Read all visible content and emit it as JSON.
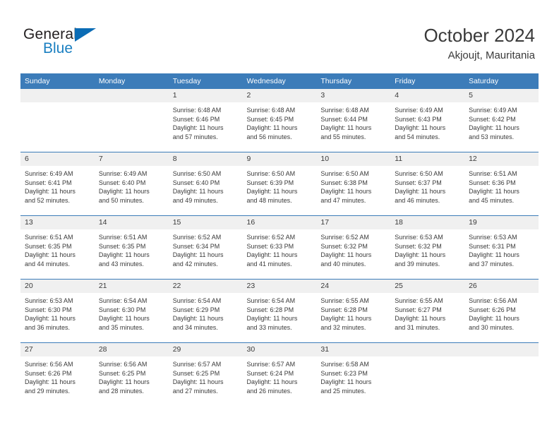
{
  "brand": {
    "line1": "General",
    "line2": "Blue",
    "triangle_icon": "brand-triangle-icon",
    "accent_color": "#0b6cb5",
    "text_blue": "#1a7fc1"
  },
  "header": {
    "title": "October 2024",
    "subtitle": "Akjoujt, Mauritania"
  },
  "theme": {
    "header_blue": "#3c7cb9",
    "daynum_band": "#f0f0f0",
    "text": "#3a3a3a"
  },
  "weekday_headers": [
    "Sunday",
    "Monday",
    "Tuesday",
    "Wednesday",
    "Thursday",
    "Friday",
    "Saturday"
  ],
  "labels": {
    "sunrise_prefix": "Sunrise:",
    "sunset_prefix": "Sunset:",
    "daylight_prefix": "Daylight:"
  },
  "weeks": [
    [
      {
        "day": "",
        "sunrise": "",
        "sunset": "",
        "daylight_line1": "",
        "daylight_line2": ""
      },
      {
        "day": "",
        "sunrise": "",
        "sunset": "",
        "daylight_line1": "",
        "daylight_line2": ""
      },
      {
        "day": "1",
        "sunrise": "Sunrise: 6:48 AM",
        "sunset": "Sunset: 6:46 PM",
        "daylight_line1": "Daylight: 11 hours",
        "daylight_line2": "and 57 minutes."
      },
      {
        "day": "2",
        "sunrise": "Sunrise: 6:48 AM",
        "sunset": "Sunset: 6:45 PM",
        "daylight_line1": "Daylight: 11 hours",
        "daylight_line2": "and 56 minutes."
      },
      {
        "day": "3",
        "sunrise": "Sunrise: 6:48 AM",
        "sunset": "Sunset: 6:44 PM",
        "daylight_line1": "Daylight: 11 hours",
        "daylight_line2": "and 55 minutes."
      },
      {
        "day": "4",
        "sunrise": "Sunrise: 6:49 AM",
        "sunset": "Sunset: 6:43 PM",
        "daylight_line1": "Daylight: 11 hours",
        "daylight_line2": "and 54 minutes."
      },
      {
        "day": "5",
        "sunrise": "Sunrise: 6:49 AM",
        "sunset": "Sunset: 6:42 PM",
        "daylight_line1": "Daylight: 11 hours",
        "daylight_line2": "and 53 minutes."
      }
    ],
    [
      {
        "day": "6",
        "sunrise": "Sunrise: 6:49 AM",
        "sunset": "Sunset: 6:41 PM",
        "daylight_line1": "Daylight: 11 hours",
        "daylight_line2": "and 52 minutes."
      },
      {
        "day": "7",
        "sunrise": "Sunrise: 6:49 AM",
        "sunset": "Sunset: 6:40 PM",
        "daylight_line1": "Daylight: 11 hours",
        "daylight_line2": "and 50 minutes."
      },
      {
        "day": "8",
        "sunrise": "Sunrise: 6:50 AM",
        "sunset": "Sunset: 6:40 PM",
        "daylight_line1": "Daylight: 11 hours",
        "daylight_line2": "and 49 minutes."
      },
      {
        "day": "9",
        "sunrise": "Sunrise: 6:50 AM",
        "sunset": "Sunset: 6:39 PM",
        "daylight_line1": "Daylight: 11 hours",
        "daylight_line2": "and 48 minutes."
      },
      {
        "day": "10",
        "sunrise": "Sunrise: 6:50 AM",
        "sunset": "Sunset: 6:38 PM",
        "daylight_line1": "Daylight: 11 hours",
        "daylight_line2": "and 47 minutes."
      },
      {
        "day": "11",
        "sunrise": "Sunrise: 6:50 AM",
        "sunset": "Sunset: 6:37 PM",
        "daylight_line1": "Daylight: 11 hours",
        "daylight_line2": "and 46 minutes."
      },
      {
        "day": "12",
        "sunrise": "Sunrise: 6:51 AM",
        "sunset": "Sunset: 6:36 PM",
        "daylight_line1": "Daylight: 11 hours",
        "daylight_line2": "and 45 minutes."
      }
    ],
    [
      {
        "day": "13",
        "sunrise": "Sunrise: 6:51 AM",
        "sunset": "Sunset: 6:35 PM",
        "daylight_line1": "Daylight: 11 hours",
        "daylight_line2": "and 44 minutes."
      },
      {
        "day": "14",
        "sunrise": "Sunrise: 6:51 AM",
        "sunset": "Sunset: 6:35 PM",
        "daylight_line1": "Daylight: 11 hours",
        "daylight_line2": "and 43 minutes."
      },
      {
        "day": "15",
        "sunrise": "Sunrise: 6:52 AM",
        "sunset": "Sunset: 6:34 PM",
        "daylight_line1": "Daylight: 11 hours",
        "daylight_line2": "and 42 minutes."
      },
      {
        "day": "16",
        "sunrise": "Sunrise: 6:52 AM",
        "sunset": "Sunset: 6:33 PM",
        "daylight_line1": "Daylight: 11 hours",
        "daylight_line2": "and 41 minutes."
      },
      {
        "day": "17",
        "sunrise": "Sunrise: 6:52 AM",
        "sunset": "Sunset: 6:32 PM",
        "daylight_line1": "Daylight: 11 hours",
        "daylight_line2": "and 40 minutes."
      },
      {
        "day": "18",
        "sunrise": "Sunrise: 6:53 AM",
        "sunset": "Sunset: 6:32 PM",
        "daylight_line1": "Daylight: 11 hours",
        "daylight_line2": "and 39 minutes."
      },
      {
        "day": "19",
        "sunrise": "Sunrise: 6:53 AM",
        "sunset": "Sunset: 6:31 PM",
        "daylight_line1": "Daylight: 11 hours",
        "daylight_line2": "and 37 minutes."
      }
    ],
    [
      {
        "day": "20",
        "sunrise": "Sunrise: 6:53 AM",
        "sunset": "Sunset: 6:30 PM",
        "daylight_line1": "Daylight: 11 hours",
        "daylight_line2": "and 36 minutes."
      },
      {
        "day": "21",
        "sunrise": "Sunrise: 6:54 AM",
        "sunset": "Sunset: 6:30 PM",
        "daylight_line1": "Daylight: 11 hours",
        "daylight_line2": "and 35 minutes."
      },
      {
        "day": "22",
        "sunrise": "Sunrise: 6:54 AM",
        "sunset": "Sunset: 6:29 PM",
        "daylight_line1": "Daylight: 11 hours",
        "daylight_line2": "and 34 minutes."
      },
      {
        "day": "23",
        "sunrise": "Sunrise: 6:54 AM",
        "sunset": "Sunset: 6:28 PM",
        "daylight_line1": "Daylight: 11 hours",
        "daylight_line2": "and 33 minutes."
      },
      {
        "day": "24",
        "sunrise": "Sunrise: 6:55 AM",
        "sunset": "Sunset: 6:28 PM",
        "daylight_line1": "Daylight: 11 hours",
        "daylight_line2": "and 32 minutes."
      },
      {
        "day": "25",
        "sunrise": "Sunrise: 6:55 AM",
        "sunset": "Sunset: 6:27 PM",
        "daylight_line1": "Daylight: 11 hours",
        "daylight_line2": "and 31 minutes."
      },
      {
        "day": "26",
        "sunrise": "Sunrise: 6:56 AM",
        "sunset": "Sunset: 6:26 PM",
        "daylight_line1": "Daylight: 11 hours",
        "daylight_line2": "and 30 minutes."
      }
    ],
    [
      {
        "day": "27",
        "sunrise": "Sunrise: 6:56 AM",
        "sunset": "Sunset: 6:26 PM",
        "daylight_line1": "Daylight: 11 hours",
        "daylight_line2": "and 29 minutes."
      },
      {
        "day": "28",
        "sunrise": "Sunrise: 6:56 AM",
        "sunset": "Sunset: 6:25 PM",
        "daylight_line1": "Daylight: 11 hours",
        "daylight_line2": "and 28 minutes."
      },
      {
        "day": "29",
        "sunrise": "Sunrise: 6:57 AM",
        "sunset": "Sunset: 6:25 PM",
        "daylight_line1": "Daylight: 11 hours",
        "daylight_line2": "and 27 minutes."
      },
      {
        "day": "30",
        "sunrise": "Sunrise: 6:57 AM",
        "sunset": "Sunset: 6:24 PM",
        "daylight_line1": "Daylight: 11 hours",
        "daylight_line2": "and 26 minutes."
      },
      {
        "day": "31",
        "sunrise": "Sunrise: 6:58 AM",
        "sunset": "Sunset: 6:23 PM",
        "daylight_line1": "Daylight: 11 hours",
        "daylight_line2": "and 25 minutes."
      },
      {
        "day": "",
        "sunrise": "",
        "sunset": "",
        "daylight_line1": "",
        "daylight_line2": ""
      },
      {
        "day": "",
        "sunrise": "",
        "sunset": "",
        "daylight_line1": "",
        "daylight_line2": ""
      }
    ]
  ]
}
